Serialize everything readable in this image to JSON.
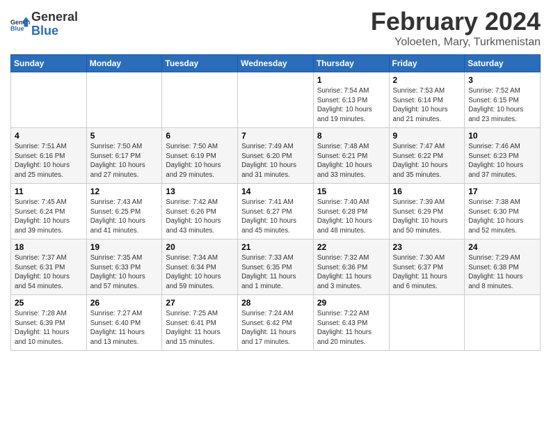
{
  "header": {
    "logo_line1": "General",
    "logo_line2": "Blue",
    "month_year": "February 2024",
    "location": "Yoloeten, Mary, Turkmenistan"
  },
  "weekdays": [
    "Sunday",
    "Monday",
    "Tuesday",
    "Wednesday",
    "Thursday",
    "Friday",
    "Saturday"
  ],
  "weeks": [
    [
      {
        "day": "",
        "info": ""
      },
      {
        "day": "",
        "info": ""
      },
      {
        "day": "",
        "info": ""
      },
      {
        "day": "",
        "info": ""
      },
      {
        "day": "1",
        "info": "Sunrise: 7:54 AM\nSunset: 6:13 PM\nDaylight: 10 hours\nand 19 minutes."
      },
      {
        "day": "2",
        "info": "Sunrise: 7:53 AM\nSunset: 6:14 PM\nDaylight: 10 hours\nand 21 minutes."
      },
      {
        "day": "3",
        "info": "Sunrise: 7:52 AM\nSunset: 6:15 PM\nDaylight: 10 hours\nand 23 minutes."
      }
    ],
    [
      {
        "day": "4",
        "info": "Sunrise: 7:51 AM\nSunset: 6:16 PM\nDaylight: 10 hours\nand 25 minutes."
      },
      {
        "day": "5",
        "info": "Sunrise: 7:50 AM\nSunset: 6:17 PM\nDaylight: 10 hours\nand 27 minutes."
      },
      {
        "day": "6",
        "info": "Sunrise: 7:50 AM\nSunset: 6:19 PM\nDaylight: 10 hours\nand 29 minutes."
      },
      {
        "day": "7",
        "info": "Sunrise: 7:49 AM\nSunset: 6:20 PM\nDaylight: 10 hours\nand 31 minutes."
      },
      {
        "day": "8",
        "info": "Sunrise: 7:48 AM\nSunset: 6:21 PM\nDaylight: 10 hours\nand 33 minutes."
      },
      {
        "day": "9",
        "info": "Sunrise: 7:47 AM\nSunset: 6:22 PM\nDaylight: 10 hours\nand 35 minutes."
      },
      {
        "day": "10",
        "info": "Sunrise: 7:46 AM\nSunset: 6:23 PM\nDaylight: 10 hours\nand 37 minutes."
      }
    ],
    [
      {
        "day": "11",
        "info": "Sunrise: 7:45 AM\nSunset: 6:24 PM\nDaylight: 10 hours\nand 39 minutes."
      },
      {
        "day": "12",
        "info": "Sunrise: 7:43 AM\nSunset: 6:25 PM\nDaylight: 10 hours\nand 41 minutes."
      },
      {
        "day": "13",
        "info": "Sunrise: 7:42 AM\nSunset: 6:26 PM\nDaylight: 10 hours\nand 43 minutes."
      },
      {
        "day": "14",
        "info": "Sunrise: 7:41 AM\nSunset: 6:27 PM\nDaylight: 10 hours\nand 45 minutes."
      },
      {
        "day": "15",
        "info": "Sunrise: 7:40 AM\nSunset: 6:28 PM\nDaylight: 10 hours\nand 48 minutes."
      },
      {
        "day": "16",
        "info": "Sunrise: 7:39 AM\nSunset: 6:29 PM\nDaylight: 10 hours\nand 50 minutes."
      },
      {
        "day": "17",
        "info": "Sunrise: 7:38 AM\nSunset: 6:30 PM\nDaylight: 10 hours\nand 52 minutes."
      }
    ],
    [
      {
        "day": "18",
        "info": "Sunrise: 7:37 AM\nSunset: 6:31 PM\nDaylight: 10 hours\nand 54 minutes."
      },
      {
        "day": "19",
        "info": "Sunrise: 7:35 AM\nSunset: 6:33 PM\nDaylight: 10 hours\nand 57 minutes."
      },
      {
        "day": "20",
        "info": "Sunrise: 7:34 AM\nSunset: 6:34 PM\nDaylight: 10 hours\nand 59 minutes."
      },
      {
        "day": "21",
        "info": "Sunrise: 7:33 AM\nSunset: 6:35 PM\nDaylight: 11 hours\nand 1 minute."
      },
      {
        "day": "22",
        "info": "Sunrise: 7:32 AM\nSunset: 6:36 PM\nDaylight: 11 hours\nand 3 minutes."
      },
      {
        "day": "23",
        "info": "Sunrise: 7:30 AM\nSunset: 6:37 PM\nDaylight: 11 hours\nand 6 minutes."
      },
      {
        "day": "24",
        "info": "Sunrise: 7:29 AM\nSunset: 6:38 PM\nDaylight: 11 hours\nand 8 minutes."
      }
    ],
    [
      {
        "day": "25",
        "info": "Sunrise: 7:28 AM\nSunset: 6:39 PM\nDaylight: 11 hours\nand 10 minutes."
      },
      {
        "day": "26",
        "info": "Sunrise: 7:27 AM\nSunset: 6:40 PM\nDaylight: 11 hours\nand 13 minutes."
      },
      {
        "day": "27",
        "info": "Sunrise: 7:25 AM\nSunset: 6:41 PM\nDaylight: 11 hours\nand 15 minutes."
      },
      {
        "day": "28",
        "info": "Sunrise: 7:24 AM\nSunset: 6:42 PM\nDaylight: 11 hours\nand 17 minutes."
      },
      {
        "day": "29",
        "info": "Sunrise: 7:22 AM\nSunset: 6:43 PM\nDaylight: 11 hours\nand 20 minutes."
      },
      {
        "day": "",
        "info": ""
      },
      {
        "day": "",
        "info": ""
      }
    ]
  ]
}
